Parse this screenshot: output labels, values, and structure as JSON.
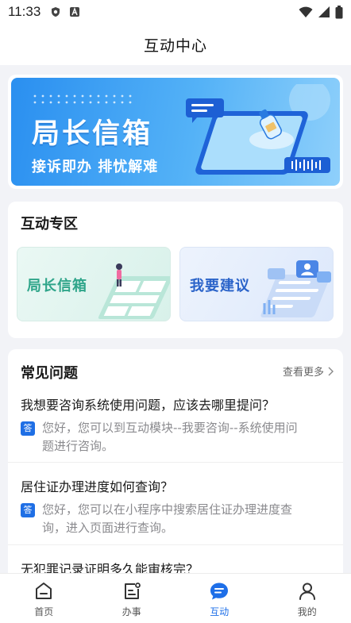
{
  "status_bar": {
    "time": "11:33",
    "left_icons": [
      "shield-app-icon",
      "font-app-icon"
    ],
    "right_icons": [
      "wifi-icon",
      "signal-icon",
      "battery-icon"
    ]
  },
  "header": {
    "title": "互动中心"
  },
  "banner": {
    "title": "局长信箱",
    "subtitle": "接诉即办 排忧解难"
  },
  "interact_zone": {
    "title": "互动专区",
    "tiles": [
      {
        "label": "局长信箱",
        "color": "#2fa58a"
      },
      {
        "label": "我要建议",
        "color": "#2a63c9"
      }
    ]
  },
  "faq": {
    "title": "常见问题",
    "more_label": "查看更多",
    "answer_badge": "答",
    "items": [
      {
        "question": "我想要咨询系统使用问题，应该去哪里提问？",
        "answer_line1": "您好，您可以到互动模块--我要咨询--系统使用问",
        "answer_line2": "题进行咨询。"
      },
      {
        "question": "居住证办理进度如何查询？",
        "answer_line1": "您好，您可以在小程序中搜索居住证办理进度查",
        "answer_line2": "询，进入页面进行查询。"
      },
      {
        "question": "无犯罪记录证明多久能审核完？"
      }
    ]
  },
  "tab_bar": {
    "active_color": "#1e6fe8",
    "items": [
      {
        "label": "首页",
        "icon": "home-icon"
      },
      {
        "label": "办事",
        "icon": "services-icon"
      },
      {
        "label": "互动",
        "icon": "chat-icon",
        "active": true
      },
      {
        "label": "我的",
        "icon": "profile-icon"
      }
    ]
  }
}
